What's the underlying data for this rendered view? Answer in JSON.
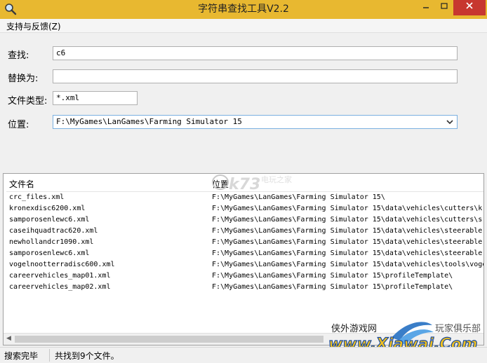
{
  "window": {
    "title": "字符串查找工具V2.2"
  },
  "menu": {
    "items": [
      {
        "label": "支持与反馈(Z)"
      }
    ]
  },
  "form": {
    "find_label": "查找:",
    "find_value": "c6",
    "replace_label": "替换为:",
    "replace_value": "",
    "filetype_label": "文件类型:",
    "filetype_value": "*.xml",
    "location_label": "位置:",
    "location_value": "F:\\MyGames\\LanGames\\Farming Simulator 15"
  },
  "results": {
    "columns": [
      "文件名",
      "位置"
    ],
    "rows": [
      {
        "name": "crc_files.xml",
        "path": "F:\\MyGames\\LanGames\\Farming Simulator 15\\"
      },
      {
        "name": "kronexdisc6200.xml",
        "path": "F:\\MyGames\\LanGames\\Farming Simulator 15\\data\\vehicles\\cutters\\k"
      },
      {
        "name": "samporosenlewc6.xml",
        "path": "F:\\MyGames\\LanGames\\Farming Simulator 15\\data\\vehicles\\cutters\\s"
      },
      {
        "name": "caseihquadtrac620.xml",
        "path": "F:\\MyGames\\LanGames\\Farming Simulator 15\\data\\vehicles\\steerable"
      },
      {
        "name": "newhollandcr1090.xml",
        "path": "F:\\MyGames\\LanGames\\Farming Simulator 15\\data\\vehicles\\steerable"
      },
      {
        "name": "samporosenlewc6.xml",
        "path": "F:\\MyGames\\LanGames\\Farming Simulator 15\\data\\vehicles\\steerable"
      },
      {
        "name": "vogelnootterradisc600.xml",
        "path": "F:\\MyGames\\LanGames\\Farming Simulator 15\\data\\vehicles\\tools\\voge"
      },
      {
        "name": "careervehicles_map01.xml",
        "path": "F:\\MyGames\\LanGames\\Farming Simulator 15\\profileTemplate\\"
      },
      {
        "name": "careervehicles_map02.xml",
        "path": "F:\\MyGames\\LanGames\\Farming Simulator 15\\profileTemplate\\"
      }
    ]
  },
  "status": {
    "state": "搜索完毕",
    "summary": "共找到9个文件。"
  },
  "watermarks": {
    "k73_site": "k73",
    "k73_cn": "电玩之家",
    "xiawai_name": "侠外游戏网",
    "xiawai_url": "www.Xiawai.Com",
    "xiawai_club": "玩家俱乐部"
  },
  "icons": {
    "app": "magnifier-icon",
    "dropdown": "chevron-down-icon",
    "minimize": "minimize-icon",
    "maximize": "maximize-icon",
    "close": "close-icon"
  },
  "colors": {
    "titlebar": "#e8b830",
    "close_button": "#c7372f",
    "field_focus_border": "#7ab0e0"
  }
}
